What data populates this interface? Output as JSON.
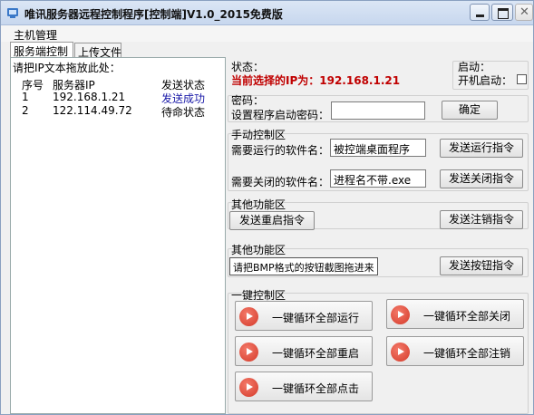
{
  "window": {
    "title": "唯讯服务器远程控制程序[控制端]V1.0_2015免费版"
  },
  "menu": {
    "main": "主机管理"
  },
  "tabs": [
    {
      "label": "服务端控制"
    },
    {
      "label": "上传文件"
    }
  ],
  "left_panel": {
    "hint": "请把IP文本拖放此处：",
    "headers": {
      "no": "序号",
      "ip": "服务器IP",
      "status": "发送状态"
    },
    "rows": [
      {
        "no": "1",
        "ip": "192.168.1.21",
        "status": "发送成功"
      },
      {
        "no": "2",
        "ip": "122.114.49.72",
        "status": "待命状态"
      }
    ]
  },
  "status_section": {
    "label": "状态：",
    "ip_text": "当前选择的IP为：192.168.1.21",
    "startup_label": "启动：",
    "autostart_label": "开机启动："
  },
  "password_section": {
    "label": "密码：",
    "set_label": "设置程序启动密码：",
    "value": "",
    "confirm": "确定"
  },
  "manual_section": {
    "label": "手动控制区",
    "run_label": "需要运行的软件名：",
    "run_value": "被控端桌面程序",
    "run_button": "发送运行指令",
    "close_label": "需要关闭的软件名：",
    "close_value": "进程名不带.exe",
    "close_button": "发送关闭指令"
  },
  "other1_section": {
    "label": "其他功能区",
    "restart_button": "发送重启指令",
    "logout_button": "发送注销指令"
  },
  "other2_section": {
    "label": "其他功能区",
    "hint": "请把BMP格式的按钮截图拖进来",
    "button": "发送按钮指令"
  },
  "onekey_section": {
    "label": "一键控制区",
    "run_all": "一键循环全部运行",
    "close_all": "一键循环全部关闭",
    "restart_all": "一键循环全部重启",
    "logout_all": "一键循环全部注销",
    "click_all": "一键循环全部点击"
  },
  "colors": {
    "status_ip": "#c00000",
    "sent_success": "#1a1aa8",
    "play_icon": "#d43a2a"
  }
}
